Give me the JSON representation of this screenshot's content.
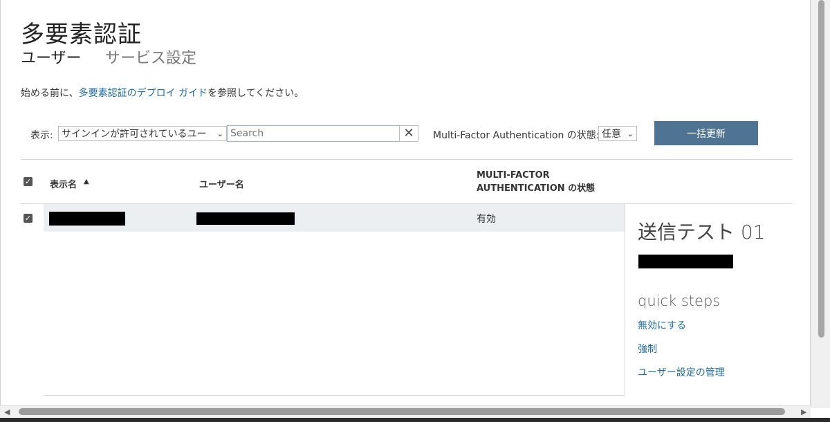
{
  "page": {
    "title": "多要素認証",
    "tabs": [
      {
        "label": "ユーザー"
      },
      {
        "label": "サービス設定"
      }
    ]
  },
  "hint": {
    "prefix": "始める前に、",
    "link": "多要素認証のデプロイ ガイド",
    "suffix": "を参照してください。"
  },
  "toolbar": {
    "view_label": "表示:",
    "view_selected": "サインインが許可されているユー",
    "search_placeholder": "Search",
    "clear_icon": "close-icon",
    "mfa_filter_label": "Multi-Factor Authentication の状態:",
    "mfa_filter_selected": "任意",
    "bulk_update_label": "一括更新"
  },
  "table": {
    "headers": {
      "display_name": "表示名",
      "username": "ユーザー名",
      "mfa_line1": "MULTI-FACTOR",
      "mfa_line2": "AUTHENTICATION の状態"
    },
    "sort": "ascending",
    "rows": [
      {
        "selected": true,
        "mfa_status": "有効"
      }
    ]
  },
  "detail": {
    "title": "送信テスト 01",
    "quick_steps_heading": "quick steps",
    "links": [
      {
        "label": "無効にする"
      },
      {
        "label": "強制"
      },
      {
        "label": "ユーザー設定の管理"
      }
    ]
  },
  "colors": {
    "link": "#1e6aa0",
    "button": "#4e7393",
    "selected_row": "#ebeff1"
  }
}
